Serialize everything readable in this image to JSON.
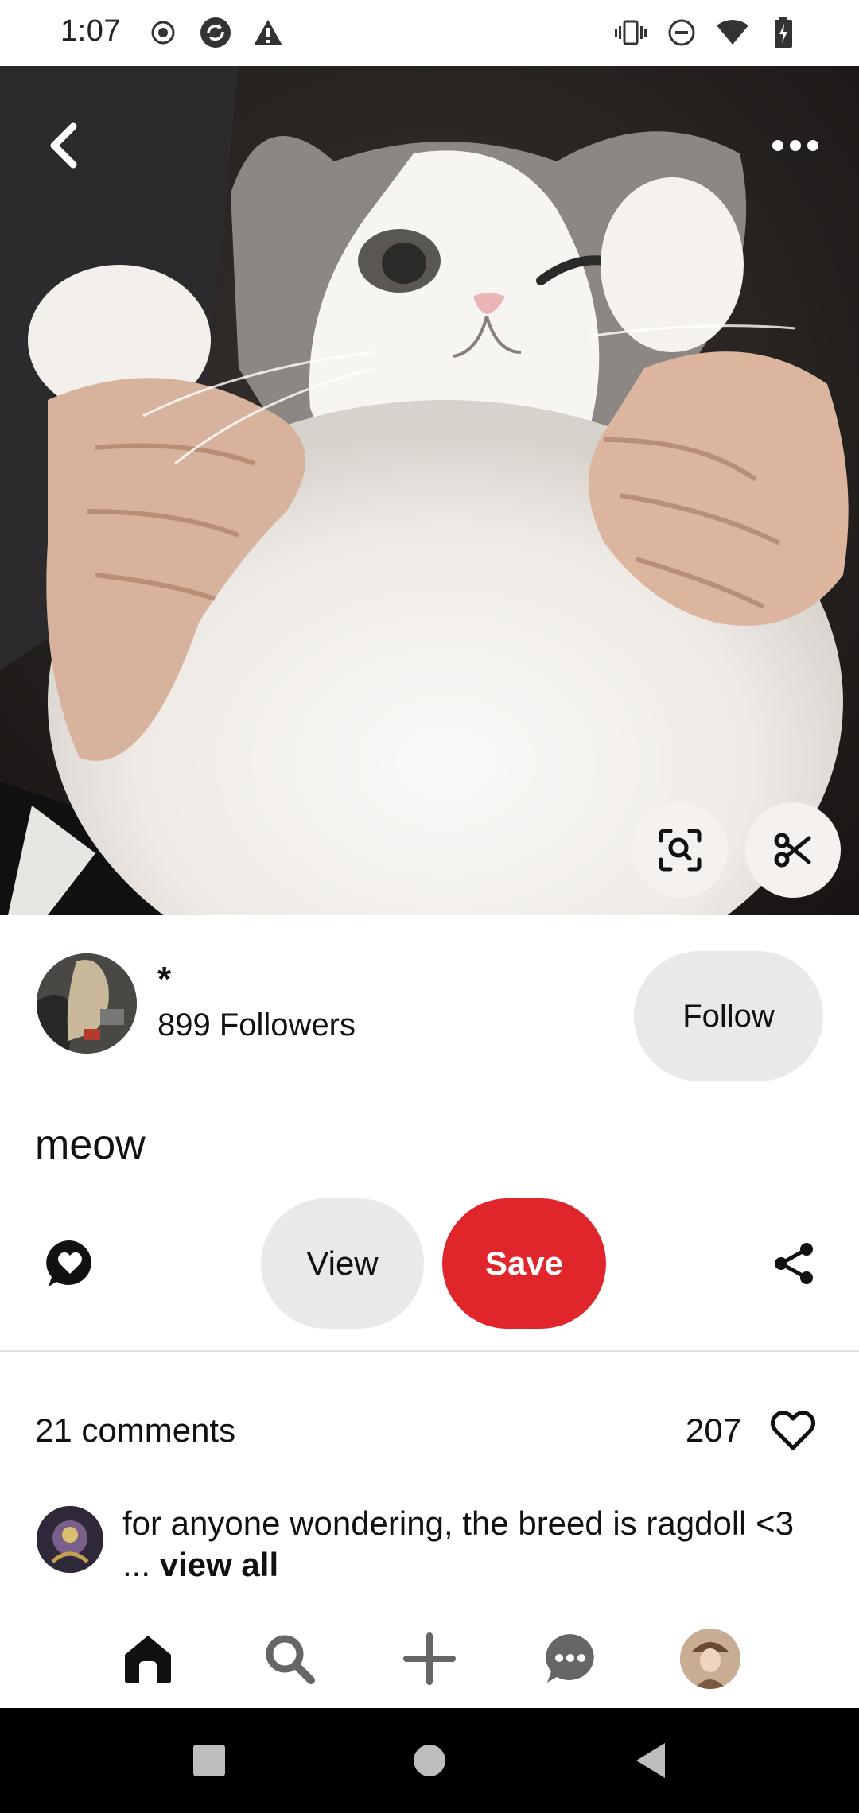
{
  "status_bar": {
    "time": "1:07"
  },
  "pin": {
    "title": "meow",
    "photo_description_icon": "cat-photo"
  },
  "creator": {
    "name": "*",
    "followers": "899 Followers",
    "follow_label": "Follow"
  },
  "actions": {
    "view_label": "View",
    "save_label": "Save"
  },
  "engagement": {
    "comments": "21 comments",
    "likes": "207"
  },
  "comment": {
    "text": "for anyone wondering, the breed is ragdoll <3 ... ",
    "view_all": "view all"
  },
  "colors": {
    "save_red": "#e0252b",
    "button_grey": "#e9e9e9",
    "system_nav": "#000000"
  }
}
